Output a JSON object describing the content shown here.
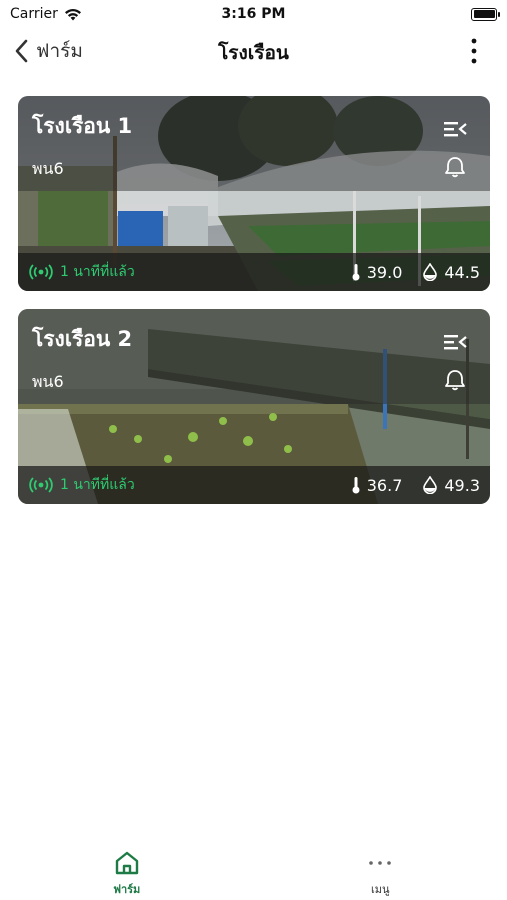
{
  "status_bar": {
    "carrier": "Carrier",
    "time": "3:16 PM"
  },
  "nav": {
    "back_label": "ฟาร์ม",
    "title": "โรงเรือน"
  },
  "cards": [
    {
      "title": "โรงเรือน 1",
      "subtitle": "พน6",
      "status_text": "1 นาทีที่แล้ว",
      "temperature": "39.0",
      "humidity": "44.5"
    },
    {
      "title": "โรงเรือน 2",
      "subtitle": "พน6",
      "status_text": "1 นาทีที่แล้ว",
      "temperature": "36.7",
      "humidity": "49.3"
    }
  ],
  "tabs": {
    "farm_label": "ฟาร์ม",
    "menu_label": "เมนู"
  },
  "colors": {
    "accent_green": "#1e7b46",
    "status_green": "#2ecc71"
  }
}
